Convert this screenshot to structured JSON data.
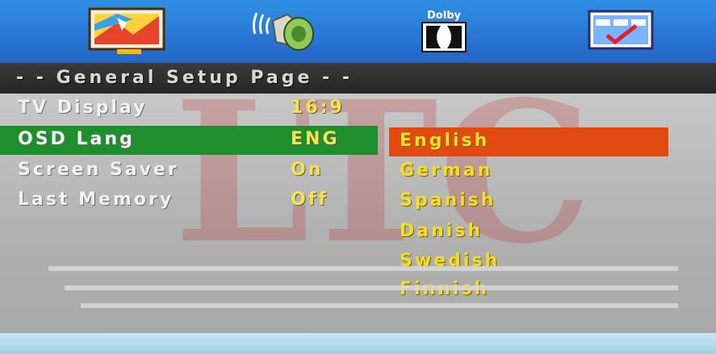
{
  "toolbar": {
    "icons": [
      {
        "name": "general-setup-icon"
      },
      {
        "name": "audio-speaker-icon"
      },
      {
        "name": "dolby-icon",
        "label": "Dolby"
      },
      {
        "name": "preference-icon"
      }
    ]
  },
  "page": {
    "title": "- -  General  Setup  Page  - -",
    "watermark": "LTC"
  },
  "settings": [
    {
      "label": "TV  Display",
      "value": "16:9"
    },
    {
      "label": "OSD  Lang",
      "value": "ENG"
    },
    {
      "label": "Screen  Saver",
      "value": "On"
    },
    {
      "label": "Last  Memory",
      "value": "Off"
    }
  ],
  "languages": [
    "English",
    "German",
    "Spanish",
    "Danish",
    "Swedish",
    "Finnish"
  ],
  "colors": {
    "topbar": "#2a78d6",
    "selected_row": "#1f8f2e",
    "selected_option": "#e24a12",
    "value_text": "#f6e34a"
  }
}
